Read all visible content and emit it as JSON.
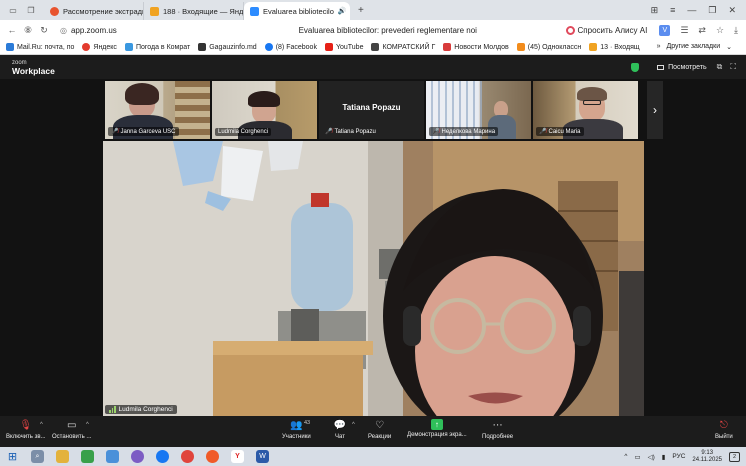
{
  "browser": {
    "tabs": [
      {
        "title": "Рассмотрение экстради",
        "color": "#e8542f"
      },
      {
        "title": "188 · Входящие — Яндек",
        "color": "#f0a322"
      },
      {
        "title": "Evaluarea bibliotecilo",
        "color": "#2d8cff",
        "active": true
      }
    ],
    "new_tab": "+",
    "address": "app.zoom.us",
    "page_title": "Evaluarea bibliotecilor: prevederi reglementare noi",
    "alice": "Спросить Алису AI",
    "bookmarks": [
      {
        "label": "Mail.Ru: почта, по",
        "color": "#2b7bd8"
      },
      {
        "label": "Яндекс",
        "color": "#e33b2e"
      },
      {
        "label": "Погода в Комрат",
        "color": "#3a98e0"
      },
      {
        "label": "Gagauzinfo.md",
        "color": "#333333"
      },
      {
        "label": "(8) Facebook",
        "color": "#1877f2"
      },
      {
        "label": "YouTube",
        "color": "#e62117"
      },
      {
        "label": "КОМРАТСКИЙ Г",
        "color": "#444444"
      },
      {
        "label": "Новости Молдов",
        "color": "#d83b3b"
      },
      {
        "label": "(45) Одноклассн",
        "color": "#f28c1c"
      },
      {
        "label": "13 · Входящ",
        "color": "#f0a322"
      }
    ],
    "other_bookmarks": "Другие закладки"
  },
  "zoom": {
    "brand_top": "zoom",
    "brand_bottom": "Workplace",
    "view": "Посмотреть",
    "participants": [
      {
        "name": "Janna Garceva USC",
        "muted": true
      },
      {
        "name": "Ludmila Corghenci",
        "muted": false,
        "speaking": true
      },
      {
        "name": "Tatiana Popazu",
        "muted": true,
        "video_off": true
      },
      {
        "name": "Неделкова Марина",
        "muted": true
      },
      {
        "name": "Caicu Maria",
        "muted": true
      }
    ],
    "main_speaker": "Ludmila Corghenci",
    "toolbar": {
      "audio": "Включить зв...",
      "video": "Остановить ...",
      "participants": "Участники",
      "participants_count": "43",
      "chat": "Чат",
      "reactions": "Реакции",
      "share": "Демонстрация экра...",
      "more": "Подробнее",
      "leave": "Выйти"
    }
  },
  "taskbar": {
    "lang": "РУС",
    "time": "9:13",
    "date": "24.11.2025",
    "notifications": "2"
  }
}
